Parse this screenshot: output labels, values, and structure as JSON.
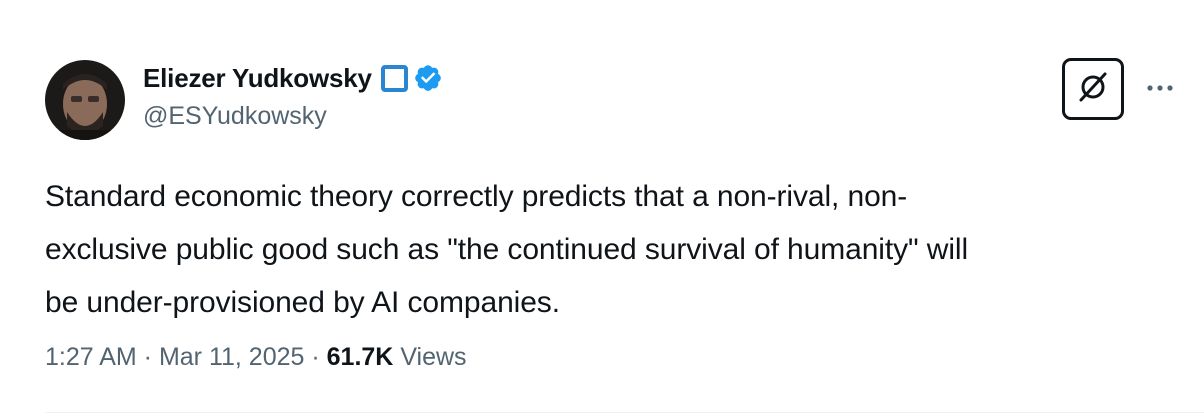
{
  "author": {
    "display_name": "Eliezer Yudkowsky",
    "handle": "@ESYudkowsky",
    "square_icon": "blue-square-icon",
    "verified_icon": "verified-badge-icon"
  },
  "tweet": {
    "text_lines": [
      "Standard economic theory correctly predicts that a non-rival, non-",
      "exclusive public good such as \"the continued survival of humanity\" will",
      "be under-provisioned by AI companies."
    ]
  },
  "meta": {
    "time": "1:27 AM",
    "separator": " · ",
    "date": "Mar 11, 2025",
    "views_count": "61.7K",
    "views_label": "Views"
  },
  "actions": {
    "grok_icon": "grok-icon",
    "more_icon": "more-icon"
  },
  "colors": {
    "verified": "#1d9bf0",
    "square": "#2b86d1",
    "secondary_text": "#536471",
    "primary_text": "#0f1419"
  }
}
